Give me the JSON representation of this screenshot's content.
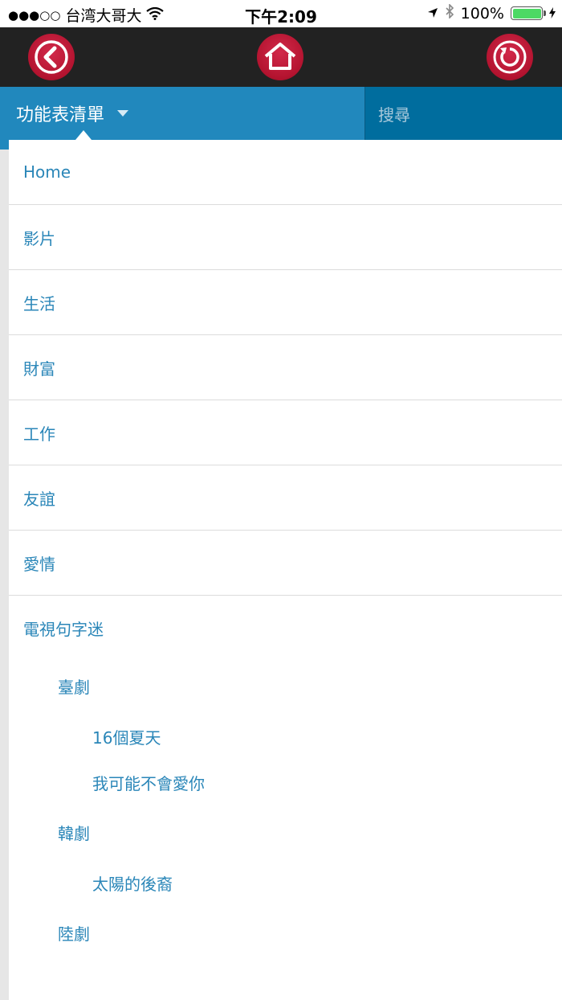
{
  "status_bar": {
    "signal": "●●●○○",
    "carrier": "台湾大哥大",
    "time": "下午2:09",
    "battery": "100%",
    "battery_level": 1.0
  },
  "nav": {
    "back_icon": "back-arrow-icon",
    "home_icon": "home-icon",
    "refresh_icon": "refresh-icon",
    "accent": "#c41a3b"
  },
  "menubar": {
    "title": "功能表清單",
    "search_placeholder": "搜尋"
  },
  "menu": {
    "items": [
      "Home",
      "影片",
      "生活",
      "財富",
      "工作",
      "友誼",
      "愛情"
    ],
    "category": "電視句字迷",
    "sub": [
      {
        "label": "臺劇",
        "children": [
          "16個夏天",
          "我可能不會愛你"
        ]
      },
      {
        "label": "韓劇",
        "children": [
          "太陽的後裔"
        ]
      },
      {
        "label": "陸劇",
        "children": []
      }
    ]
  },
  "colors": {
    "menu_blue": "#2188bd",
    "search_blue": "#006d9e",
    "link_text": "#2a86b8",
    "topbar": "#222222"
  }
}
